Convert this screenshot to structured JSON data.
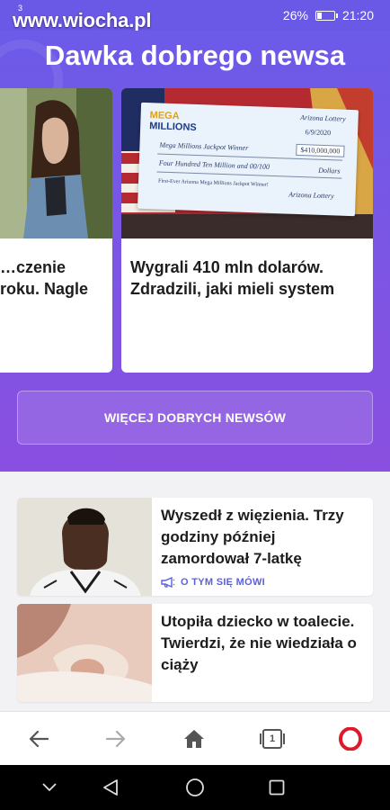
{
  "status_bar": {
    "watermark": "www.wiocha.pl",
    "superscript": "3",
    "battery_percent": "26%",
    "battery_level": 0.26,
    "time": "21:20"
  },
  "hero": {
    "title": "Dawka dobrego newsa",
    "cards": [
      {
        "title": "…czenie roku. Nagle"
      },
      {
        "title": "Wygrali 410 mln dolarów. Zdradzili, jaki mieli system",
        "check": {
          "brand_top": "MEGA",
          "brand_bottom": "MILLIONS",
          "issuer": "Arizona Lottery",
          "date": "6/9/2020",
          "payee": "Mega Millions Jackpot Winner",
          "amount": "$410,000,000",
          "amount_words": "Four Hundred Ten Million and 00/100",
          "currency": "Dollars",
          "memo": "First-Ever Arizona Mega Millions Jackpot Winner!",
          "signature": "Arizona Lottery"
        }
      }
    ],
    "more_button": "WIĘCEJ DOBRYCH NEWSÓW"
  },
  "news": [
    {
      "headline": "Wyszedł z więzienia. Trzy godziny później zamordował 7-latkę",
      "tag": "O TYM SIĘ MÓWI"
    },
    {
      "headline": "Utopiła dziecko w toalecie. Twierdzi, że nie wiedziała o ciąży",
      "tag": ""
    }
  ],
  "browser_bar": {
    "tab_count": "1",
    "icons": [
      "back-arrow-icon",
      "forward-arrow-icon",
      "home-icon",
      "tabs-icon",
      "opera-icon"
    ]
  },
  "android_nav": {
    "icons": [
      "chevron-down-icon",
      "back-triangle-icon",
      "home-circle-icon",
      "recents-square-icon"
    ]
  },
  "colors": {
    "hero_gradient_top": "#6c5ae8",
    "hero_gradient_bottom": "#8a4fe0",
    "tag_color": "#5b5fe0",
    "opera_red": "#e0192a"
  }
}
